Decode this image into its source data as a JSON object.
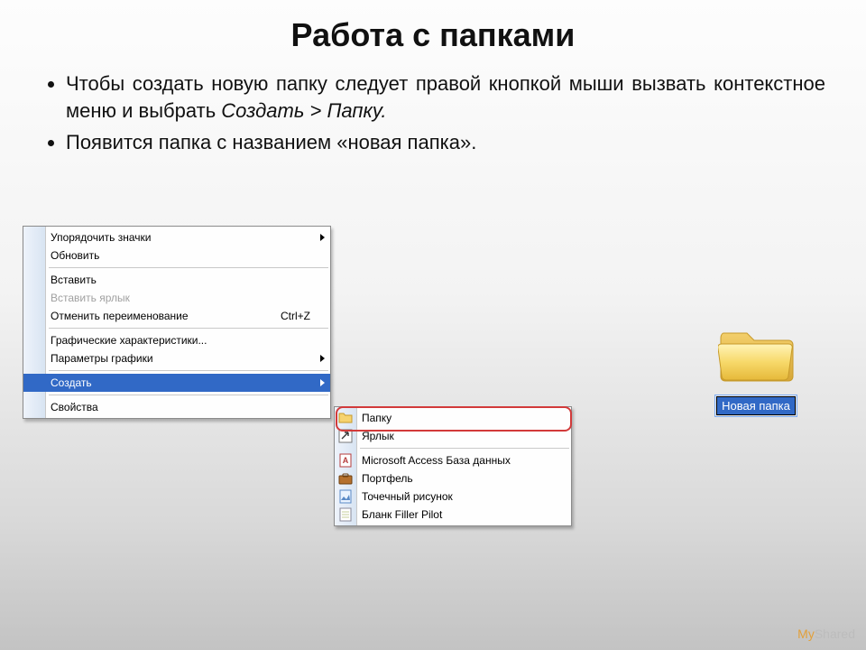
{
  "title": "Работа с папками",
  "bullet1_part1": "Чтобы создать новую папку следует правой кнопкой мыши вызвать контекстное меню и выбрать ",
  "bullet1_em": "Создать > Папку.",
  "bullet2": "Появится папка с названием «новая папка».",
  "context_menu": {
    "arrange_icons": {
      "label": "Упорядочить значки",
      "has_submenu": true
    },
    "refresh": {
      "label": "Обновить"
    },
    "paste": {
      "label": "Вставить"
    },
    "paste_shortcut": {
      "label": "Вставить ярлык",
      "disabled": true
    },
    "undo_rename": {
      "label": "Отменить переименование",
      "shortcut": "Ctrl+Z"
    },
    "gfx_props": {
      "label": "Графические характеристики..."
    },
    "gfx_params": {
      "label": "Параметры графики",
      "has_submenu": true
    },
    "create": {
      "label": "Создать",
      "has_submenu": true,
      "selected": true
    },
    "properties": {
      "label": "Свойства"
    }
  },
  "submenu": {
    "folder": {
      "label": "Папку"
    },
    "shortcut": {
      "label": "Ярлык"
    },
    "access_db": {
      "label": "Microsoft Access База данных"
    },
    "briefcase": {
      "label": "Портфель"
    },
    "bitmap": {
      "label": "Точечный рисунок"
    },
    "filler": {
      "label": "Бланк Filler Pilot"
    }
  },
  "new_folder_label": "Новая папка",
  "watermark": {
    "my": "My",
    "shared": "Shared"
  }
}
